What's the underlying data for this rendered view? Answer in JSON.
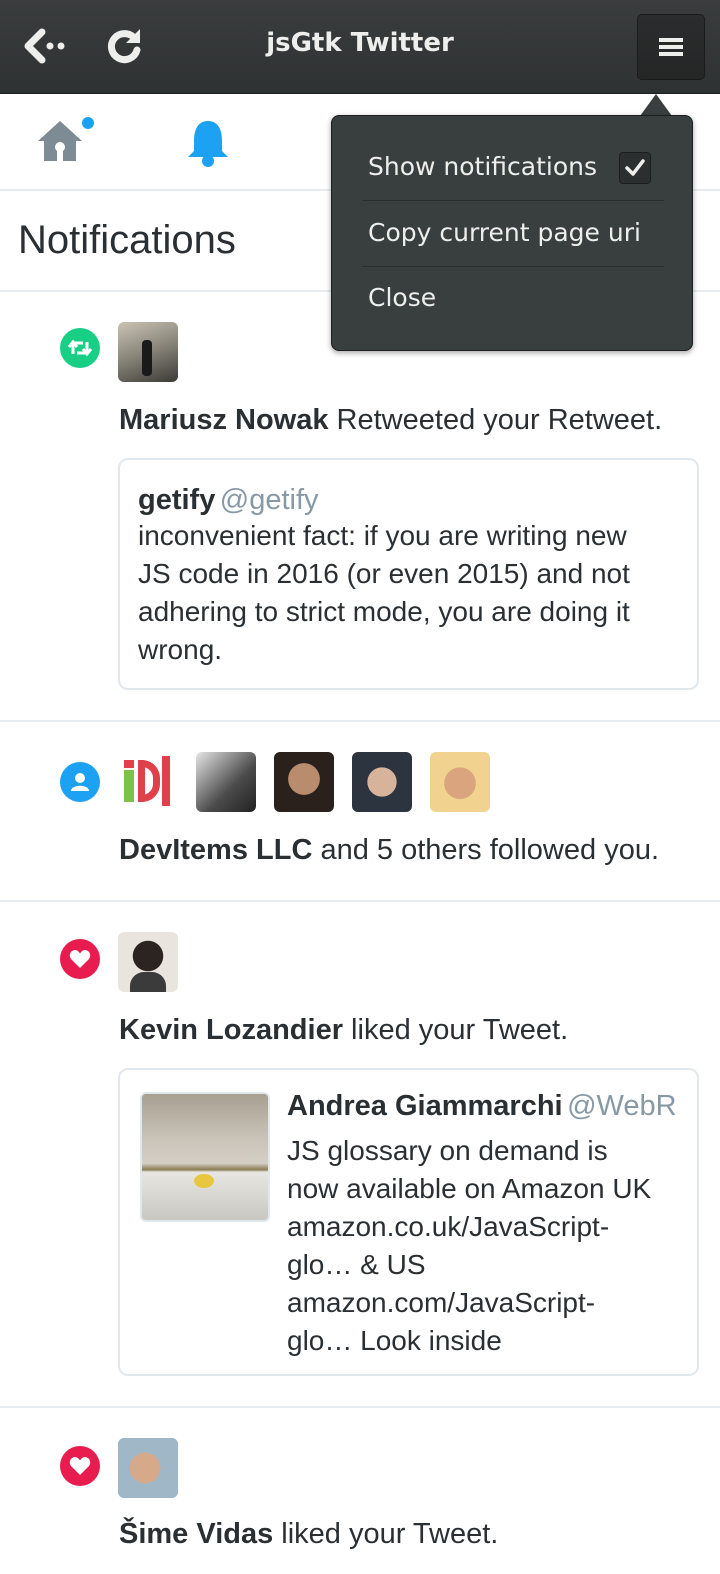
{
  "header": {
    "title": "jsGtk Twitter",
    "back_icon": "back-arrow-icon",
    "refresh_icon": "refresh-icon",
    "menu_icon": "hamburger-menu-icon"
  },
  "tabs": [
    {
      "name": "home",
      "icon": "home-icon",
      "has_unread_dot": true
    },
    {
      "name": "notifications",
      "icon": "bell-icon",
      "active": true
    }
  ],
  "page": {
    "title": "Notifications"
  },
  "menu": {
    "items": [
      {
        "label": "Show notifications",
        "checked": true
      },
      {
        "label": "Copy current page uri"
      },
      {
        "label": "Close"
      }
    ]
  },
  "notifications": [
    {
      "type": "retweet",
      "icon": "retweet-icon",
      "icon_color": "#19cf86",
      "actor": "Mariusz Nowak",
      "action": " Retweeted your Retweet.",
      "tweet": {
        "name": "getify",
        "handle": "@getify",
        "text_lines": [
          "inconvenient fact: if you are writing new",
          "JS code in 2016 (or even 2015) and not",
          "adhering to strict mode, you are doing it",
          "wrong."
        ]
      }
    },
    {
      "type": "follow",
      "icon": "person-icon",
      "icon_color": "#1da1f2",
      "actor": "DevItems LLC",
      "action": " and 5 others followed you."
    },
    {
      "type": "like",
      "icon": "heart-icon",
      "icon_color": "#e81c4f",
      "actor": "Kevin Lozandier",
      "action": " liked your Tweet.",
      "tweet": {
        "name": "Andrea Giammarchi",
        "handle": "@WebR",
        "text_lines": [
          "JS glossary on demand is",
          "now available on Amazon UK",
          "amazon.co.uk/JavaScript-",
          "glo… & US",
          "amazon.com/JavaScript-",
          "glo… Look inside"
        ]
      }
    },
    {
      "type": "like",
      "icon": "heart-icon",
      "icon_color": "#e81c4f",
      "actor": "Šime Vidas",
      "action": " liked your Tweet."
    }
  ]
}
